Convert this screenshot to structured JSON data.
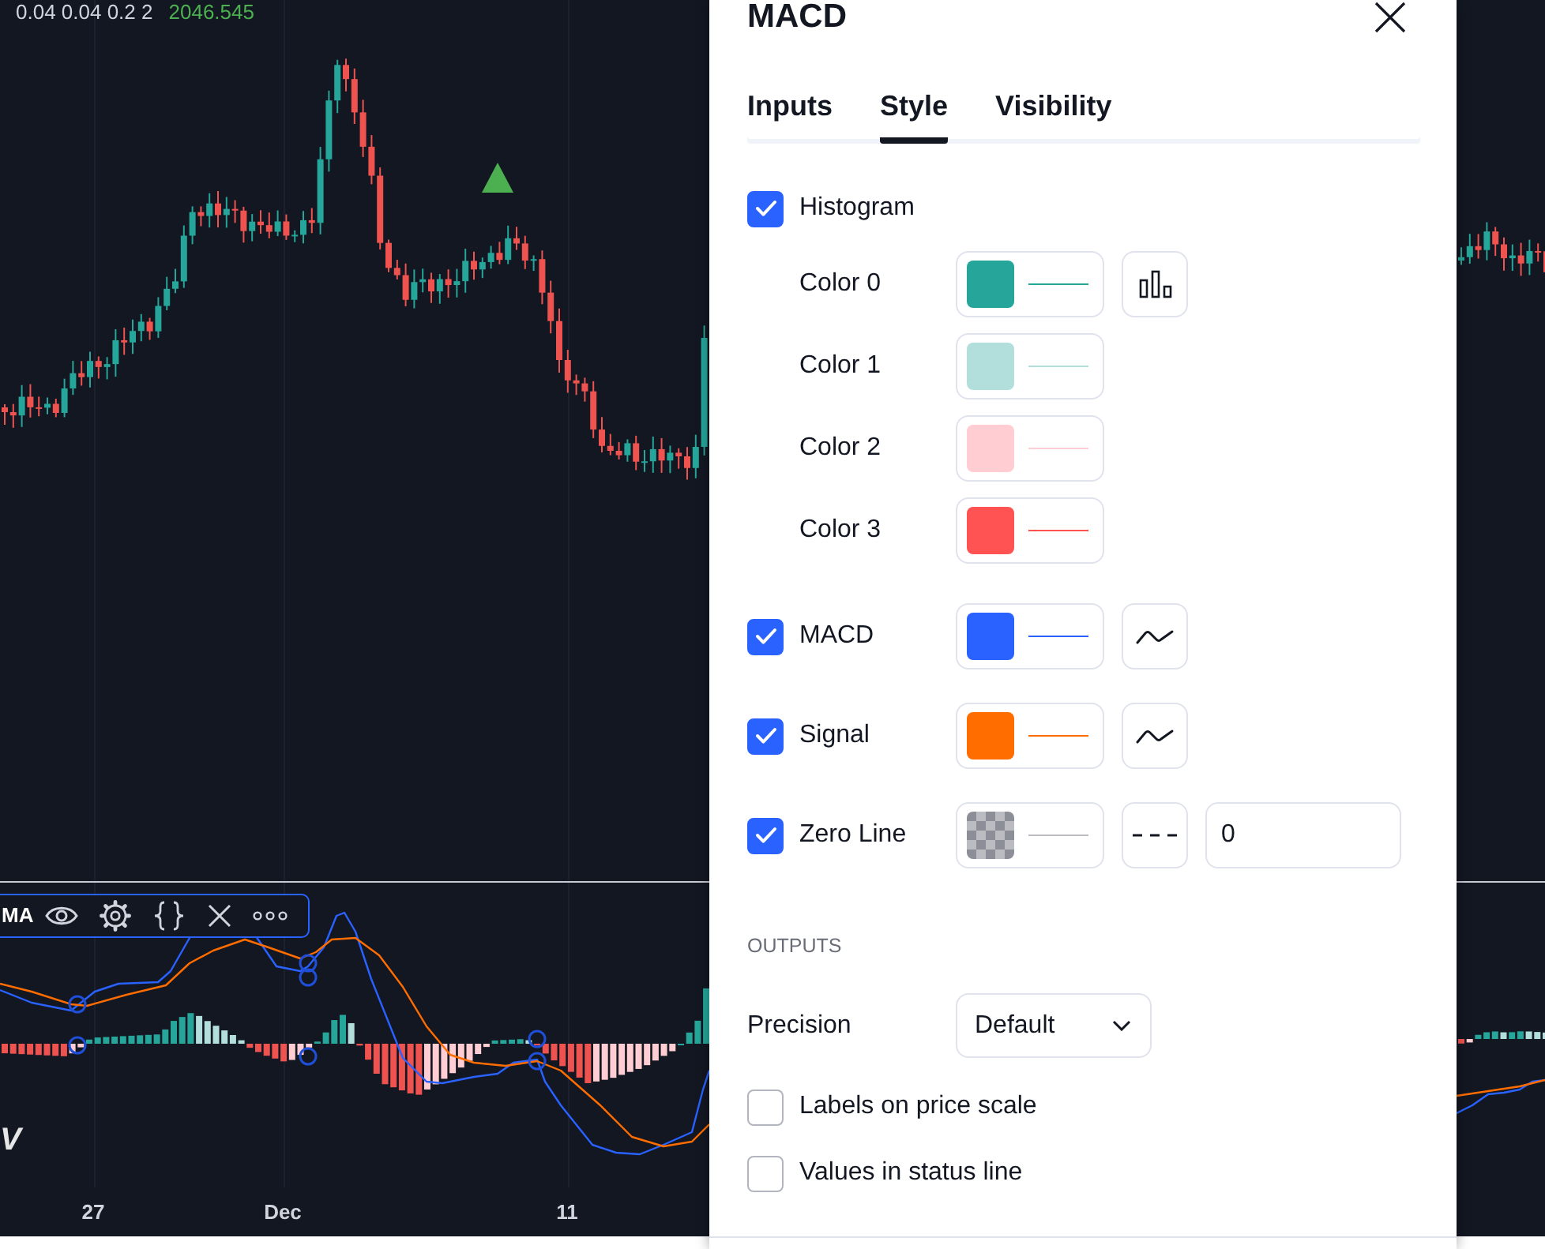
{
  "chart": {
    "legend": {
      "values": "0.04 0.04 0.2 2",
      "price": "2046.545"
    },
    "indicator_toolbar": {
      "name": "MA"
    },
    "logo_text": "V",
    "time_axis": [
      "27",
      "Dec",
      "11"
    ]
  },
  "dialog": {
    "title": "MACD",
    "tabs": [
      {
        "label": "Inputs",
        "selected": false
      },
      {
        "label": "Style",
        "selected": true
      },
      {
        "label": "Visibility",
        "selected": false
      }
    ],
    "plots": [
      {
        "kind": "toggle",
        "label": "Histogram",
        "checked": true
      },
      {
        "kind": "color",
        "label": "Color 0",
        "color": "#26a69a",
        "transparent": false,
        "style_button": {
          "kind": "columns"
        }
      },
      {
        "kind": "color",
        "label": "Color 1",
        "color": "#b2dfdb",
        "transparent": false
      },
      {
        "kind": "color",
        "label": "Color 2",
        "color": "#ffcdd2",
        "transparent": false
      },
      {
        "kind": "color",
        "label": "Color 3",
        "color": "#ff5252",
        "transparent": false
      },
      {
        "kind": "plot",
        "label": "MACD",
        "checked": true,
        "color": "#2962ff",
        "transparent": false,
        "style_button": {
          "kind": "line"
        }
      },
      {
        "kind": "plot",
        "label": "Signal",
        "checked": true,
        "color": "#ff6d00",
        "transparent": false,
        "style_button": {
          "kind": "line"
        }
      },
      {
        "kind": "plot",
        "label": "Zero Line",
        "checked": true,
        "color": "#8c8f98",
        "transparent": true,
        "style_button": {
          "kind": "dashed"
        },
        "value": "0"
      }
    ],
    "outputs": {
      "heading": "OUTPUTS",
      "precision": {
        "label": "Precision",
        "value": "Default"
      },
      "options": [
        {
          "label": "Labels on price scale",
          "checked": false
        },
        {
          "label": "Values in status line",
          "checked": false
        }
      ]
    }
  }
}
